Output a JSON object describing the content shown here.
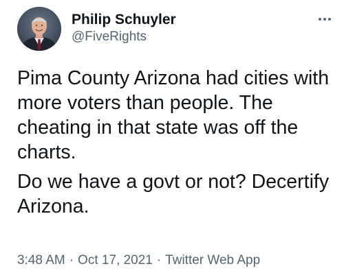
{
  "author": {
    "display_name": "Philip Schuyler",
    "handle": "@FiveRights",
    "avatar_icon": "profile-photo-man-in-suit"
  },
  "header": {
    "more_icon": "more-horizontal-icon"
  },
  "tweet": {
    "paragraphs": [
      "Pima County Arizona had cities with more voters than people. The cheating in that state was off the charts.",
      "Do we have a govt or not? Decertify Arizona."
    ]
  },
  "meta": {
    "time": "3:48 AM",
    "separator": "·",
    "date": "Oct 17, 2021",
    "source": "Twitter Web App"
  },
  "colors": {
    "text_primary": "#0f1419",
    "text_secondary": "#536471",
    "background": "#ffffff"
  }
}
